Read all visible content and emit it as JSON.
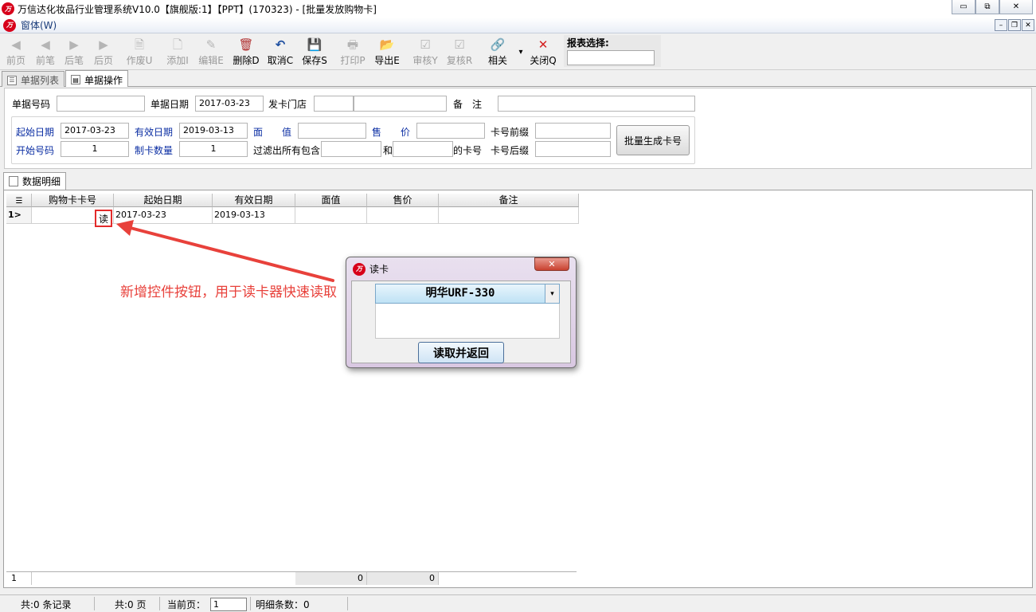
{
  "window": {
    "title": "万信达化妆品行业管理系统V10.0【旗舰版:1】【PPT】(170323) - [批量发放购物卡]",
    "logo_text": "万",
    "min_icon": "▭",
    "max_icon": "⧉",
    "close_icon": "✕"
  },
  "mdi": {
    "menu_label": "窗体(W)",
    "min_icon": "–",
    "restore_icon": "❐",
    "close_icon": "✕"
  },
  "toolbar": {
    "items": [
      {
        "label": "前页",
        "icon": "◀",
        "icon_name": "first-page-icon"
      },
      {
        "label": "前笔",
        "icon": "◀",
        "icon_name": "prev-record-icon"
      },
      {
        "label": "后笔",
        "icon": "▶",
        "icon_name": "next-record-icon"
      },
      {
        "label": "后页",
        "icon": "▶",
        "icon_name": "last-page-icon"
      },
      {
        "label": "作废U",
        "icon": "🗎",
        "icon_name": "void-icon"
      },
      {
        "label": "添加I",
        "icon": "🗋",
        "icon_name": "add-icon"
      },
      {
        "label": "编辑E",
        "icon": "✎",
        "icon_name": "edit-icon"
      },
      {
        "label": "删除D",
        "icon": "🗑",
        "icon_name": "delete-icon"
      },
      {
        "label": "取消C",
        "icon": "↶",
        "icon_name": "undo-icon"
      },
      {
        "label": "保存S",
        "icon": "💾",
        "icon_name": "save-icon"
      },
      {
        "label": "打印P",
        "icon": "🖶",
        "icon_name": "print-icon"
      },
      {
        "label": "导出E",
        "icon": "📂",
        "icon_name": "export-icon"
      },
      {
        "label": "审核Y",
        "icon": "☑",
        "icon_name": "audit-icon"
      },
      {
        "label": "复核R",
        "icon": "☑",
        "icon_name": "recheck-icon"
      },
      {
        "label": "相关",
        "icon": "🔗",
        "icon_name": "link-icon"
      },
      {
        "label": "关闭Q",
        "icon": "✕",
        "icon_name": "close-icon"
      }
    ],
    "dropdown_icon": "▾",
    "report_select_label": "报表选择:"
  },
  "tabs": [
    {
      "label": "单据列表",
      "icon": "☰"
    },
    {
      "label": "单据操作",
      "icon": "▤"
    }
  ],
  "form": {
    "doc_no_label": "单据号码",
    "doc_no_value": "",
    "doc_date_label": "单据日期",
    "doc_date_value": "2017-03-23",
    "store_label": "发卡门店",
    "store_value": "",
    "remark_label": "备　注",
    "remark_value": "",
    "start_date_label": "起始日期",
    "start_date_value": "2017-03-23",
    "valid_date_label": "有效日期",
    "valid_date_value": "2019-03-13",
    "face_value_label": "面　　值",
    "face_value_value": "",
    "price_label": "售　　价",
    "price_value": "",
    "prefix_label": "卡号前缀",
    "prefix_value": "",
    "start_no_label": "开始号码",
    "start_no_value": "1",
    "count_label": "制卡数量",
    "count_value": "1",
    "filter_label": "过滤出所有包含",
    "filter_value_1": "",
    "and_label": "和",
    "filter_value_2": "",
    "card_no_label": "的卡号",
    "suffix_label": "卡号后缀",
    "suffix_value": "",
    "batch_button": "批量生成卡号"
  },
  "detail": {
    "tab_label": "数据明细",
    "columns": [
      "购物卡卡号",
      "起始日期",
      "有效日期",
      "面值",
      "售价",
      "备注"
    ],
    "rows": [
      {
        "indicator": "1>",
        "card_no": "",
        "start_date": "2017-03-23",
        "valid_date": "2019-03-13",
        "face_value": "",
        "price": "",
        "remark": ""
      }
    ],
    "read_button": "读",
    "footer": {
      "count": "1",
      "face_total": "0",
      "price_total": "0"
    }
  },
  "annotation": {
    "text": "新增控件按钮，用于读卡器快速读取",
    "color": "#e8413b"
  },
  "dialog": {
    "title": "读卡",
    "close_icon": "✕",
    "reader_value": "明华URF-330",
    "dropdown_icon": "▾",
    "read_button": "读取并返回"
  },
  "statusbar": {
    "records": "共:0 条记录",
    "pages": "共:0 页",
    "current_label": "当前页：",
    "current_value": "1",
    "detail_count": "明细条数：0"
  }
}
